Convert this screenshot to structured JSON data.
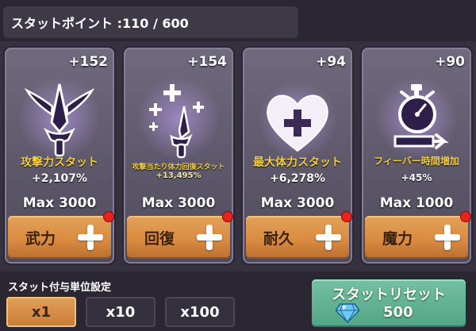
{
  "header": {
    "stat_points": "スタットポイント :110 / 600"
  },
  "cards": [
    {
      "bonus": "+152",
      "title": "攻撃力スタット",
      "value": "+2,107%",
      "max": "Max 3000",
      "button": "武力",
      "icon": "sword-wings-icon",
      "has_badge": true
    },
    {
      "bonus": "+154",
      "title": "攻撃当たり体力回復スタット",
      "value": "+13,495%",
      "max": "Max 3000",
      "button": "回復",
      "icon": "sword-sparkle-icon",
      "has_badge": true
    },
    {
      "bonus": "+94",
      "title": "最大体力スタット",
      "value": "+6,278%",
      "max": "Max 3000",
      "button": "耐久",
      "icon": "heart-plus-icon",
      "has_badge": true
    },
    {
      "bonus": "+90",
      "title": "フィーバー時間増加",
      "value": "+45%",
      "max": "Max 1000",
      "button": "魔力",
      "icon": "stopwatch-icon",
      "has_badge": true
    }
  ],
  "unit": {
    "label": "スタット付与単位設定",
    "options": [
      "x1",
      "x10",
      "x100"
    ],
    "selected": "x1"
  },
  "reset": {
    "label": "スタットリセット",
    "cost": "500",
    "icon": "diamond-gem-icon"
  },
  "colors": {
    "accent_orange": "#d9893f",
    "reset_green": "#52a585",
    "title_yellow": "#f6cf3c",
    "badge_red": "#e8231e"
  }
}
